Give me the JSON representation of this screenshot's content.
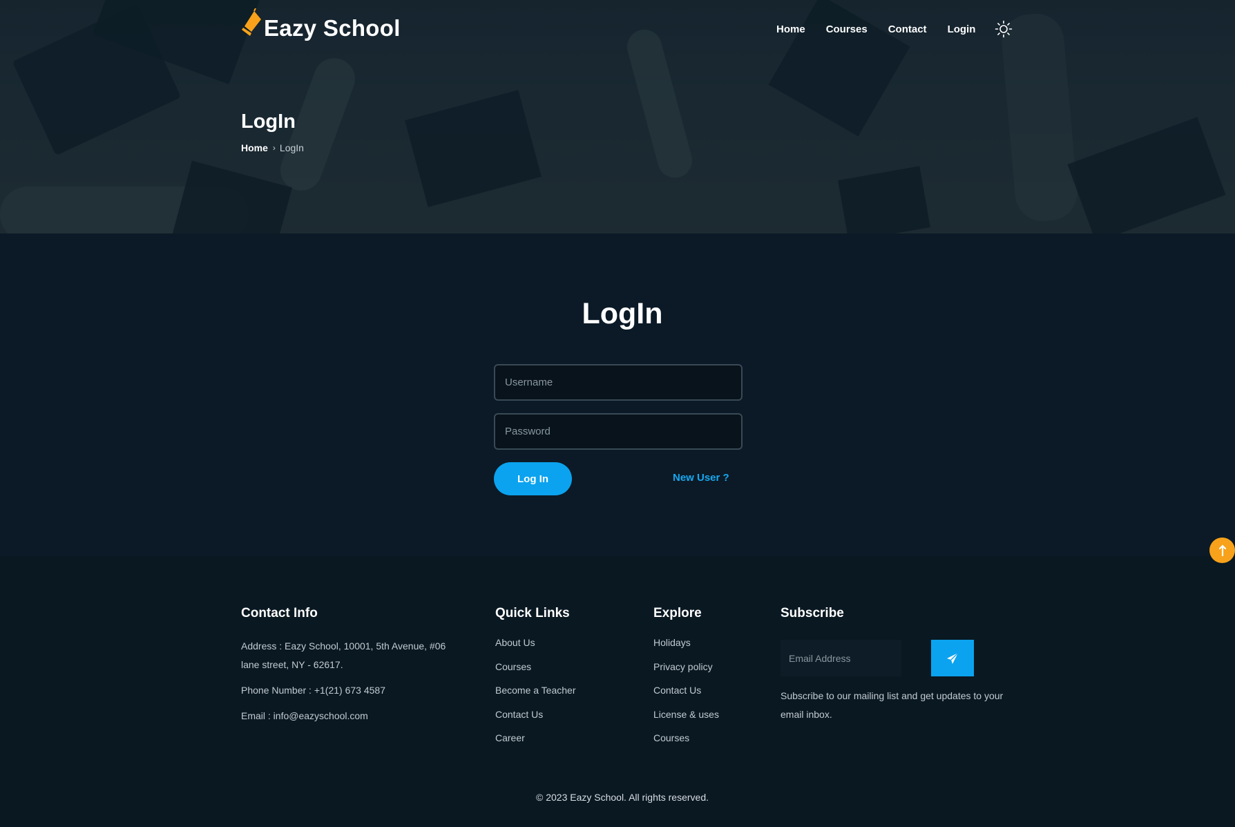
{
  "brand": {
    "name": "Eazy School",
    "accent": "#f7a21a"
  },
  "nav": {
    "items": [
      "Home",
      "Courses",
      "Contact",
      "Login"
    ],
    "theme_icon": "sun-icon"
  },
  "hero": {
    "title": "LogIn",
    "breadcrumb": {
      "home": "Home",
      "separator": "›",
      "current": "LogIn"
    }
  },
  "login": {
    "title": "LogIn",
    "username_placeholder": "Username",
    "password_placeholder": "Password",
    "button": "Log In",
    "new_user": "New User ?",
    "primary_color": "#0ba3ef"
  },
  "footer": {
    "contact": {
      "heading": "Contact Info",
      "address": "Address : Eazy School, 10001, 5th Avenue, #06 lane street, NY - 62617.",
      "phone": "Phone Number : +1(21) 673 4587",
      "email": "Email : info@eazyschool.com"
    },
    "quick_links": {
      "heading": "Quick Links",
      "items": [
        "About Us",
        "Courses",
        "Become a Teacher",
        "Contact Us",
        "Career"
      ]
    },
    "explore": {
      "heading": "Explore",
      "items": [
        "Holidays",
        "Privacy policy",
        "Contact Us",
        "License & uses",
        "Courses"
      ]
    },
    "subscribe": {
      "heading": "Subscribe",
      "placeholder": "Email Address",
      "button_icon": "send-icon",
      "text": "Subscribe to our mailing list and get updates to your email inbox."
    },
    "copyright": "© 2023 Eazy School. All rights reserved."
  },
  "scroll_top_icon": "arrow-up-icon"
}
